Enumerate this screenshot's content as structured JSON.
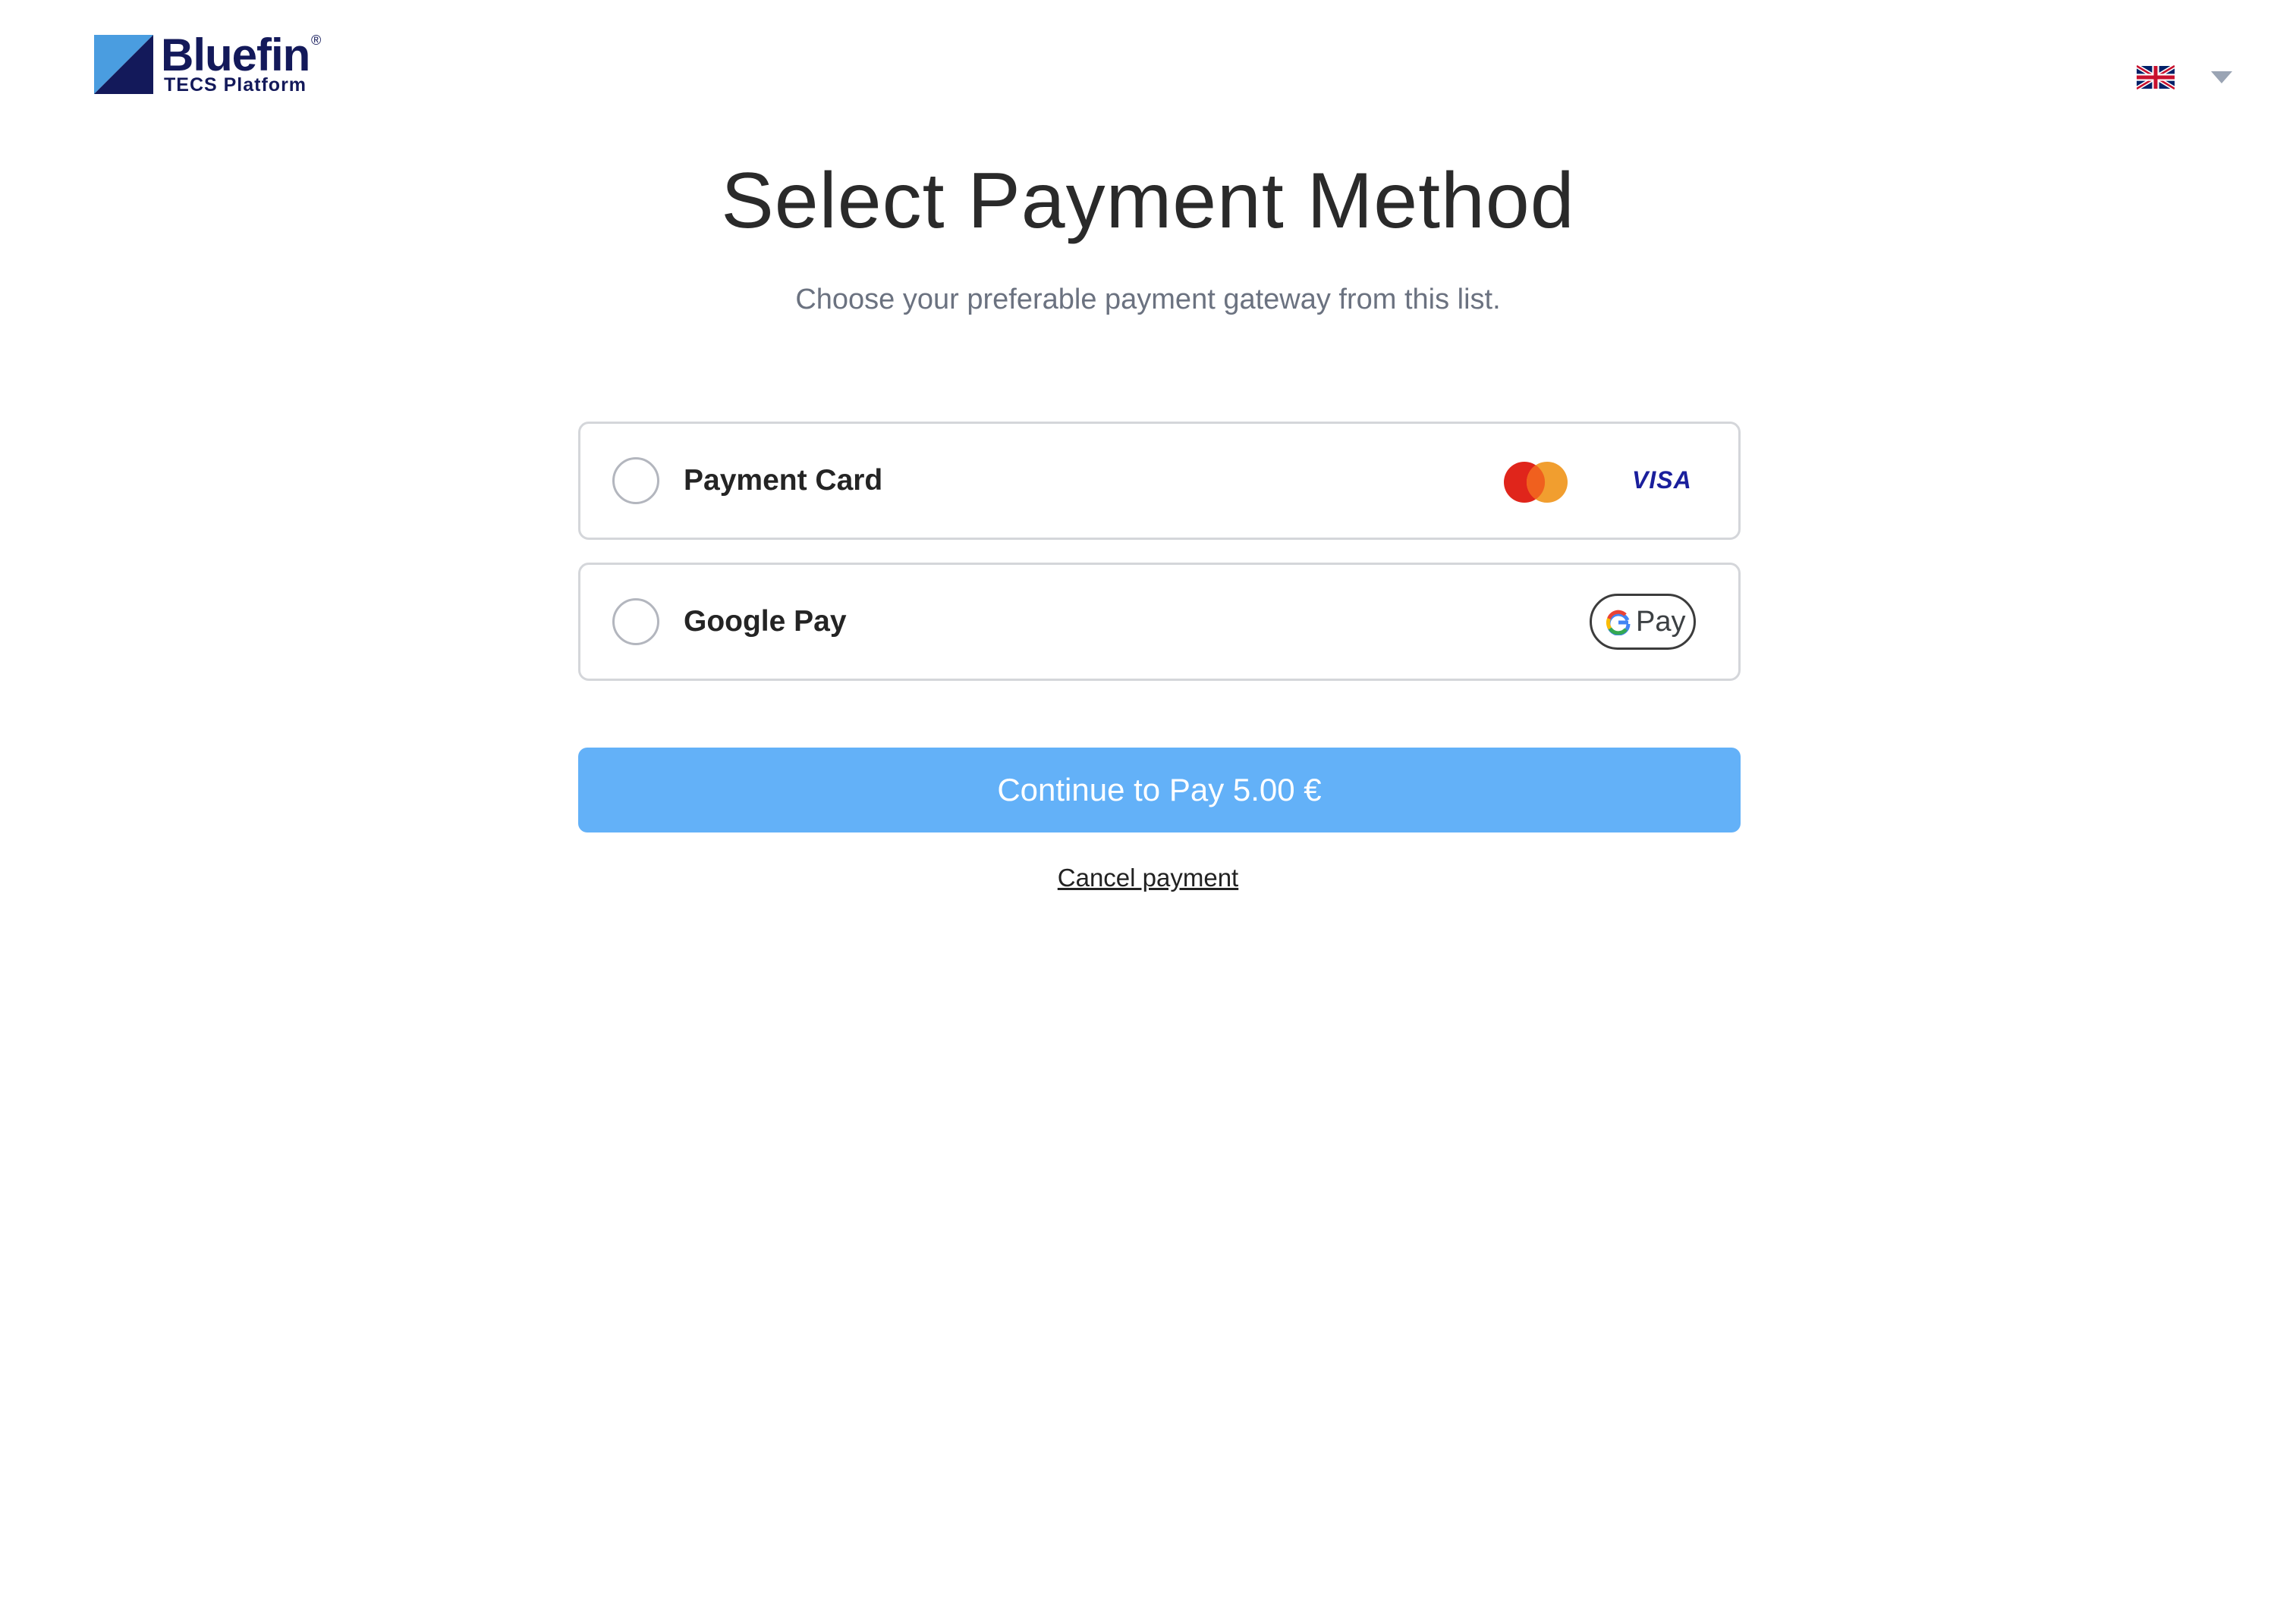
{
  "header": {
    "brand": "Bluefin",
    "brand_registered": "®",
    "brand_subtitle": "TECS Platform",
    "language": {
      "flag_icon": "uk-flag-icon",
      "caret_icon": "chevron-down-icon"
    }
  },
  "main": {
    "title": "Select Payment Method",
    "subtitle": "Choose your preferable payment gateway from this list."
  },
  "payment_options": [
    {
      "label": "Payment Card",
      "selected": false,
      "logos": [
        "mastercard-icon",
        "visa-icon"
      ],
      "visa_text": "VISA"
    },
    {
      "label": "Google Pay",
      "selected": false,
      "logos": [
        "google-pay-icon"
      ],
      "gpay_text": "Pay"
    }
  ],
  "actions": {
    "continue_label": "Continue to Pay 5.00 €",
    "cancel_label": "Cancel payment"
  },
  "colors": {
    "brand_navy": "#13195a",
    "brand_blue": "#4a9de0",
    "button_blue": "#63b1f8",
    "mastercard_red": "#e0251b",
    "mastercard_orange": "#f19e2f",
    "visa_blue": "#1a1f9c"
  }
}
